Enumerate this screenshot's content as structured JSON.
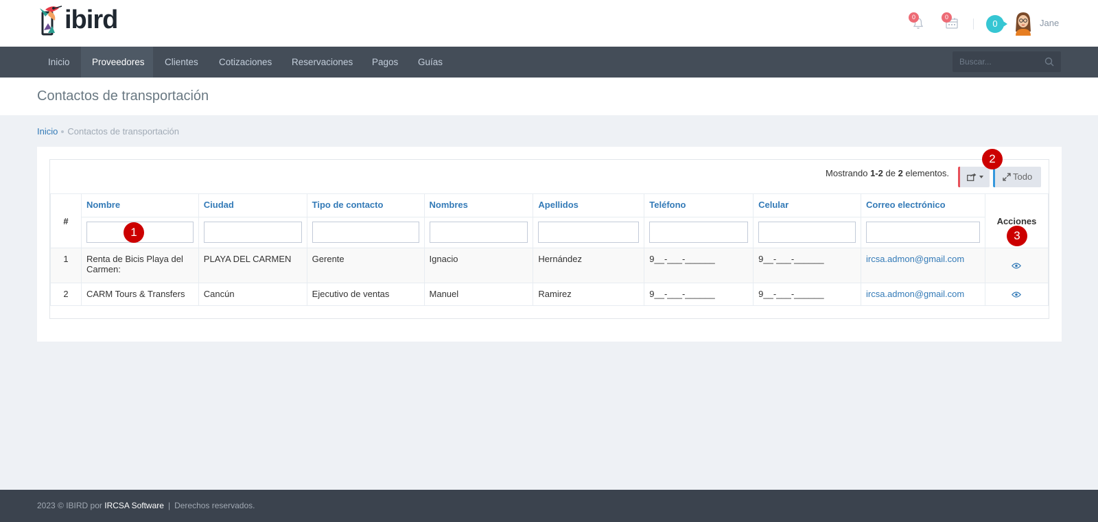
{
  "app": {
    "logo_text": "ibird"
  },
  "header": {
    "notifications_count": "0",
    "calendar_count": "0",
    "cart_count": "0",
    "user_name": "Jane"
  },
  "nav": {
    "items": [
      {
        "label": "Inicio"
      },
      {
        "label": "Proveedores"
      },
      {
        "label": "Clientes"
      },
      {
        "label": "Cotizaciones"
      },
      {
        "label": "Reservaciones"
      },
      {
        "label": "Pagos"
      },
      {
        "label": "Guías"
      }
    ],
    "active": "Proveedores",
    "search_placeholder": "Buscar..."
  },
  "page": {
    "title": "Contactos de transportación",
    "breadcrumb": {
      "home": "Inicio",
      "current": "Contactos de transportación"
    }
  },
  "grid": {
    "summary_prefix": "Mostrando ",
    "summary_range": "1-2",
    "summary_mid": " de ",
    "summary_total": "2",
    "summary_suffix": " elementos.",
    "todo_label": "Todo",
    "columns": [
      "#",
      "Nombre",
      "Ciudad",
      "Tipo de contacto",
      "Nombres",
      "Apellidos",
      "Teléfono",
      "Celular",
      "Correo electrónico",
      "Acciones"
    ],
    "rows": [
      [
        "1",
        "Renta de Bicis Playa del Carmen:",
        "PLAYA DEL CARMEN",
        "Gerente",
        "Ignacio",
        "Hernández",
        "9__-___-______",
        "9__-___-______",
        "ircsa.admon@gmail.com"
      ],
      [
        "2",
        "CARM Tours & Transfers",
        "Cancún",
        "Ejecutivo de ventas",
        "Manuel",
        "Ramirez",
        "9__-___-______",
        "9__-___-______",
        "ircsa.admon@gmail.com"
      ]
    ]
  },
  "markers": [
    "1",
    "2",
    "3"
  ],
  "footer": {
    "prefix": "2023 © IBIRD por ",
    "brand": "IRCSA Software",
    "separator": "|",
    "rights": "Derechos reservados."
  },
  "colors": {
    "nav_bg": "#444d58",
    "accent": "#337ab7",
    "marker": "#cc0000",
    "badge": "#ed6b75",
    "cart": "#36c6d3"
  }
}
